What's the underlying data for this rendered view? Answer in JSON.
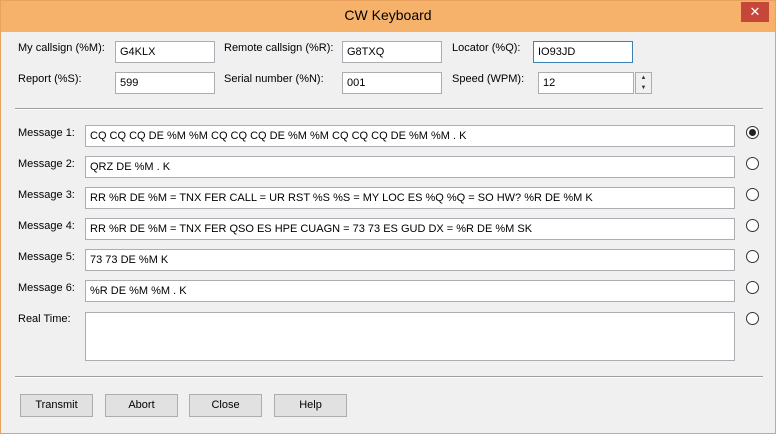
{
  "window": {
    "title": "CW Keyboard",
    "close_glyph": "✕"
  },
  "fields": {
    "my_callsign": {
      "label": "My callsign (%M):",
      "value": "G4KLX"
    },
    "remote_callsign": {
      "label": "Remote callsign (%R):",
      "value": "G8TXQ"
    },
    "locator": {
      "label": "Locator (%Q):",
      "value": "IO93JD"
    },
    "report": {
      "label": "Report (%S):",
      "value": "599"
    },
    "serial_number": {
      "label": "Serial number (%N):",
      "value": "001"
    },
    "speed": {
      "label": "Speed (WPM):",
      "value": "12"
    }
  },
  "messages": [
    {
      "label": "Message 1:",
      "value": "CQ CQ CQ DE %M %M CQ CQ CQ DE %M %M CQ CQ CQ DE %M %M . K",
      "selected": true
    },
    {
      "label": "Message 2:",
      "value": "QRZ DE %M . K",
      "selected": false
    },
    {
      "label": "Message 3:",
      "value": "RR %R DE %M = TNX FER CALL = UR RST %S %S = MY LOC ES %Q %Q = SO HW? %R DE %M K",
      "selected": false
    },
    {
      "label": "Message 4:",
      "value": "RR %R DE %M = TNX FER QSO ES HPE CUAGN = 73 73 ES GUD DX = %R DE %M SK",
      "selected": false
    },
    {
      "label": "Message 5:",
      "value": "73 73 DE %M K",
      "selected": false
    },
    {
      "label": "Message 6:",
      "value": "%R DE %M %M . K",
      "selected": false
    }
  ],
  "real_time": {
    "label": "Real Time:",
    "value": ""
  },
  "buttons": {
    "transmit": "Transmit",
    "abort": "Abort",
    "close": "Close",
    "help": "Help"
  },
  "icons": {
    "spin_up": "▲",
    "spin_down": "▼"
  }
}
